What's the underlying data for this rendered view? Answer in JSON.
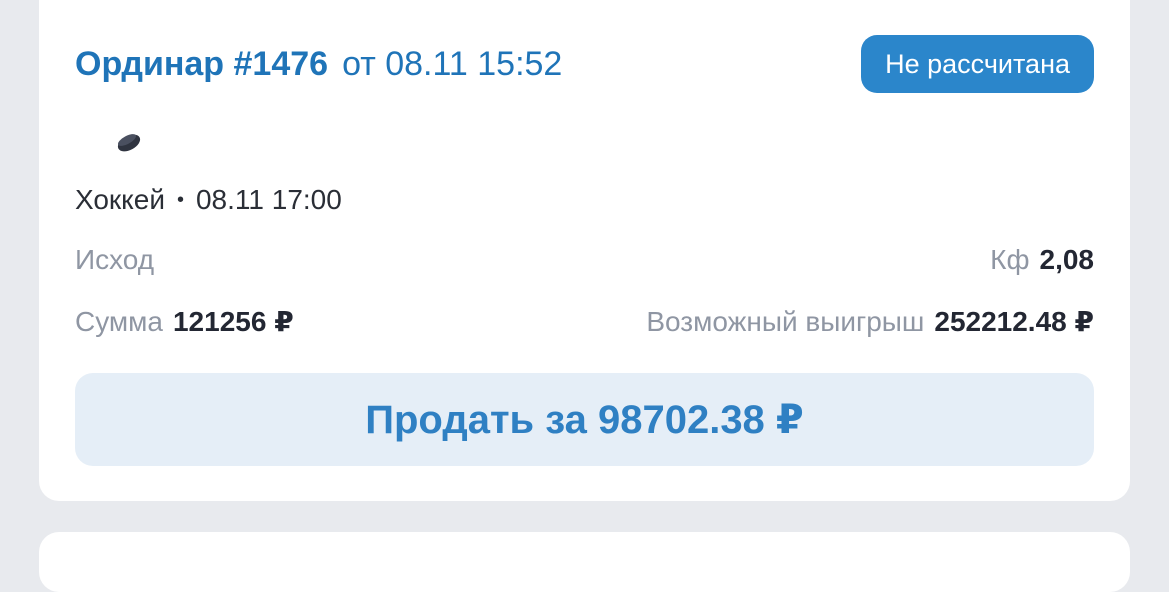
{
  "bet": {
    "type": "Ординар #1476",
    "date": "от 08.11 15:52",
    "status": "Не рассчитана",
    "sport_icon": "hockey-puck-icon",
    "event_sport": "Хоккей",
    "event_sep": "•",
    "event_time": "08.11 17:00",
    "outcome_label": "Исход",
    "coef_label": "Кф",
    "coef_value": "2,08",
    "sum_label": "Сумма",
    "sum_value": "121256 ₽",
    "win_label": "Возможный выигрыш",
    "win_value": "252212.48 ₽",
    "sell_button": "Продать за 98702.38 ₽"
  },
  "colors": {
    "accent": "#1f74b8",
    "badge_bg": "#2b86cb",
    "button_bg": "#e5eef7",
    "page_bg": "#e8eaee"
  }
}
